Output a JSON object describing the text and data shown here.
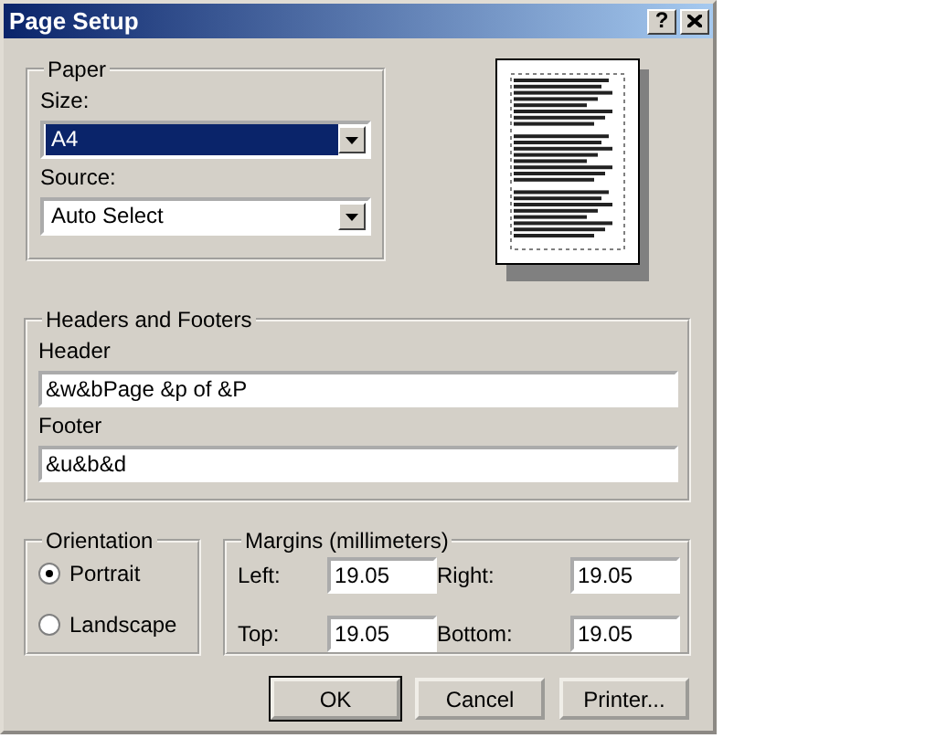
{
  "window": {
    "title": "Page Setup",
    "help_button": "?"
  },
  "paper": {
    "title": "Paper",
    "size_label": "Size:",
    "size": {
      "value": "A4",
      "focused": true
    },
    "source_label": "Source:",
    "source": {
      "value": "Auto Select",
      "focused": false
    }
  },
  "headers_and_footers": {
    "title": "Headers and Footers",
    "header_label": "Header",
    "header": "&w&bPage &p of &P",
    "footer_label": "Footer",
    "footer": "&u&b&d"
  },
  "orientation": {
    "title": "Orientation",
    "options": [
      {
        "label": "Portrait",
        "selected": true
      },
      {
        "label": "Landscape",
        "selected": false
      }
    ]
  },
  "margins": {
    "title": "Margins (millimeters)",
    "fields": [
      {
        "label": "Left:",
        "value": "19.05"
      },
      {
        "label": "Right:",
        "value": "19.05"
      },
      {
        "label": "Top:",
        "value": "19.05"
      },
      {
        "label": "Bottom:",
        "value": "19.05"
      }
    ]
  },
  "buttons": [
    {
      "label": "OK",
      "default": true
    },
    {
      "label": "Cancel",
      "default": false
    },
    {
      "label": "Printer...",
      "default": false
    }
  ]
}
